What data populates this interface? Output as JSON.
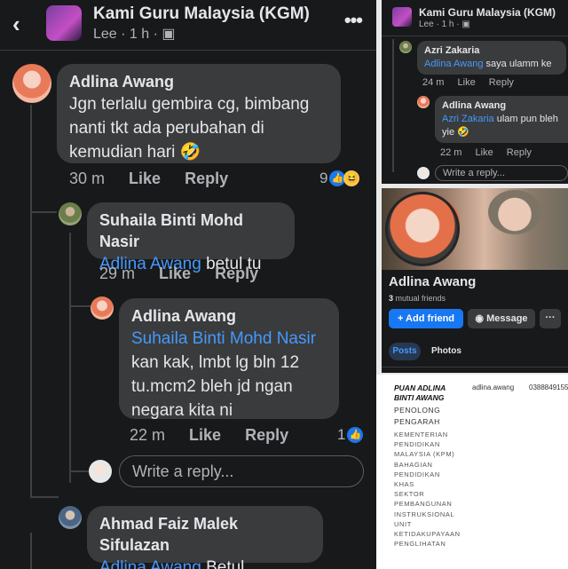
{
  "main": {
    "header": {
      "back_icon": "chevron-left-icon",
      "title": "Kami Guru Malaysia (KGM)",
      "subtitle": "Lee · 1 h · ",
      "subtitle_icon": "group-icon",
      "more_icon": "more-dots-icon"
    },
    "comments": [
      {
        "author": "Adlina Awang",
        "text": "Jgn terlalu gembira cg, bimbang nanti tkt ada perubahan di kemudian hari 🤣",
        "time": "30 m",
        "like": "Like",
        "reply": "Reply",
        "reaction_count": "9"
      },
      {
        "author": "Suhaila Binti Mohd Nasir",
        "mention": "Adlina Awang",
        "text": " betul tu",
        "time": "29 m",
        "like": "Like",
        "reply": "Reply"
      },
      {
        "author": "Adlina Awang",
        "mention": "Suhaila Binti Mohd Nasir",
        "text": "kan kak, lmbt lg bln 12 tu.mcm2 bleh jd ngan negara kita ni",
        "time": "22 m",
        "like": "Like",
        "reply": "Reply",
        "reaction_count": "1"
      },
      {
        "author": "Ahmad Faiz Malek Sifulazan",
        "mention": "Adlina Awang",
        "text": " Betul."
      }
    ],
    "reply_placeholder": "Write a reply..."
  },
  "top_right": {
    "title": "Kami Guru Malaysia (KGM)",
    "subtitle": "Lee · 1 h · ",
    "comments": [
      {
        "author": "Azri Zakaria",
        "mention": "Adlina Awang",
        "text": " saya ulamm ke",
        "time": "24 m",
        "like": "Like",
        "reply": "Reply"
      },
      {
        "author": "Adlina Awang",
        "mention": "Azri Zakaria",
        "text": " ulam pun bleh yie 🤣",
        "time": "22 m",
        "like": "Like",
        "reply": "Reply"
      }
    ],
    "reply_placeholder": "Write a reply..."
  },
  "profile": {
    "name": "Adlina Awang",
    "mutual_count": "3",
    "mutual_label": " mutual friends",
    "add_friend": "+ Add friend",
    "message": "Message",
    "more": "···",
    "tab_posts": "Posts",
    "tab_photos": "Photos"
  },
  "card": {
    "name_line1": "PUAN ADLINA",
    "name_line2": "BINTI AWANG",
    "role_line1": "PENOLONG",
    "role_line2": "PENGARAH",
    "org_lines": [
      "KEMENTERIAN",
      "PENDIDIKAN",
      "MALAYSIA (KPM)",
      "BAHAGIAN",
      "PENDIDIKAN",
      "KHAS",
      "SEKTOR",
      "PEMBANGUNAN",
      "INSTRUKSIONAL",
      "UNIT",
      "KETIDAKUPAYAAN",
      "PENGLIHATAN"
    ],
    "email": "adlina.awang",
    "phone": "0388849155"
  }
}
